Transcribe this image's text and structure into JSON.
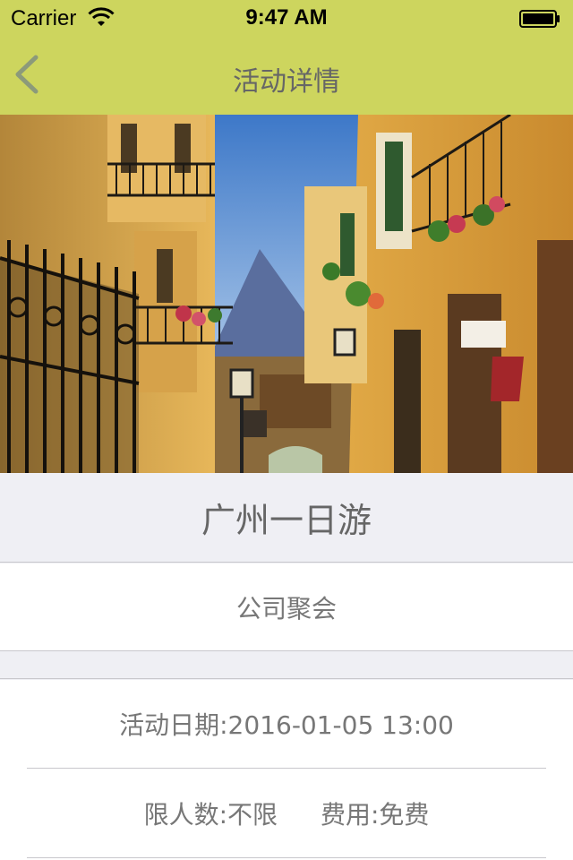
{
  "status_bar": {
    "carrier": "Carrier",
    "time": "9:47 AM"
  },
  "nav": {
    "title": "活动详情",
    "back_icon": "chevron-left-icon",
    "bar_color": "#cdd55e",
    "back_color": "#8c9a7a"
  },
  "activity": {
    "name": "广州一日游",
    "category": "公司聚会",
    "date_text": "活动日期:2016-01-05 13:00",
    "limit_text": "限人数:不限",
    "fee_text": "费用:免费"
  }
}
